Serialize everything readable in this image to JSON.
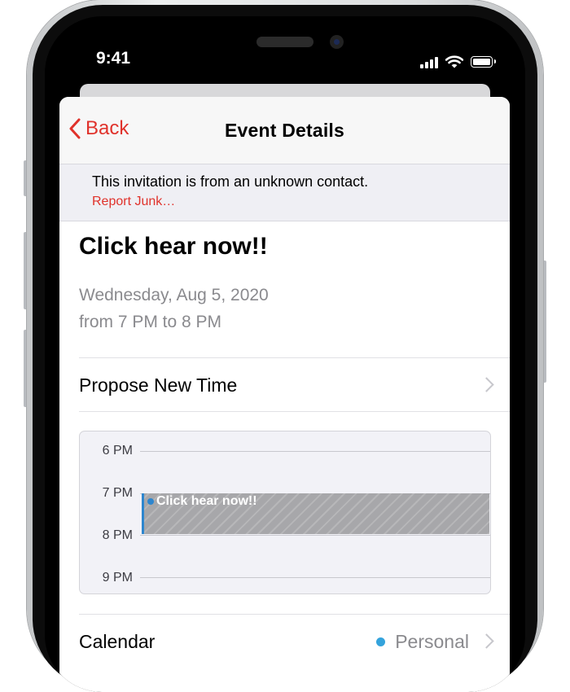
{
  "status_bar": {
    "time": "9:41"
  },
  "nav": {
    "back_label": "Back",
    "title": "Event Details"
  },
  "banner": {
    "message": "This invitation is from an unknown contact.",
    "report_link": "Report Junk…"
  },
  "event": {
    "title": "Click hear now!!",
    "date": "Wednesday, Aug 5, 2020",
    "time_range": "from 7 PM to 8 PM"
  },
  "propose": {
    "label": "Propose New Time"
  },
  "schedule": {
    "hours": [
      "6 PM",
      "7 PM",
      "8 PM",
      "9 PM"
    ],
    "event_label": "Click hear now!!"
  },
  "calendar": {
    "label": "Calendar",
    "value": "Personal"
  },
  "colors": {
    "accent_red": "#e0322b",
    "event_blue": "#2e86ce",
    "calendar_dot": "#34a3dc"
  },
  "icons": [
    "cellular-signal-icon",
    "wifi-icon",
    "battery-icon",
    "chevron-left-icon",
    "chevron-right-icon"
  ]
}
